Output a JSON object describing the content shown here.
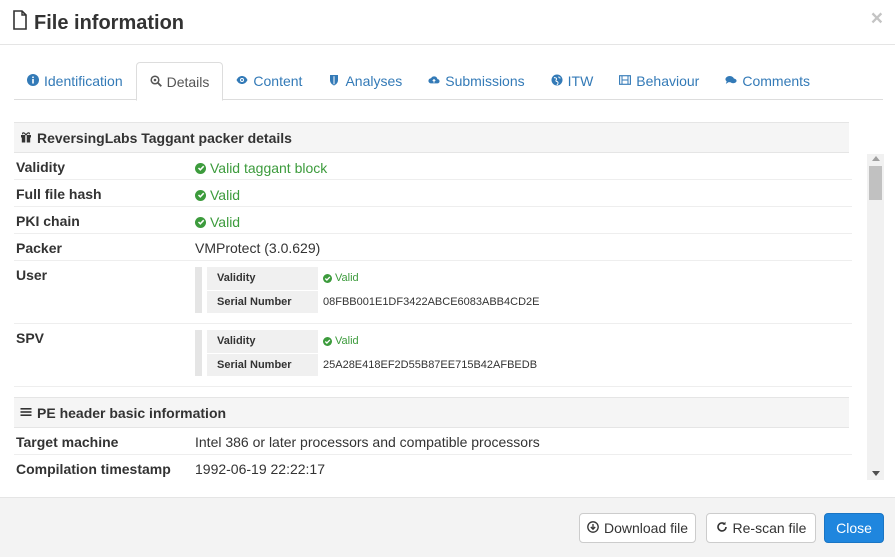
{
  "modal": {
    "title": "File information",
    "close_glyph": "×"
  },
  "tabs": [
    {
      "label": "Identification",
      "icon": "info-circle-icon",
      "active": false
    },
    {
      "label": "Details",
      "icon": "zoom-icon",
      "active": true
    },
    {
      "label": "Content",
      "icon": "eye-icon",
      "active": false
    },
    {
      "label": "Analyses",
      "icon": "shield-icon",
      "active": false
    },
    {
      "label": "Submissions",
      "icon": "cloud-upload-icon",
      "active": false
    },
    {
      "label": "ITW",
      "icon": "globe-icon",
      "active": false
    },
    {
      "label": "Behaviour",
      "icon": "film-icon",
      "active": false
    },
    {
      "label": "Comments",
      "icon": "comments-icon",
      "active": false
    }
  ],
  "taggant": {
    "title": "ReversingLabs Taggant packer details",
    "rows": {
      "validity": {
        "key": "Validity",
        "value": "Valid taggant block"
      },
      "full_hash": {
        "key": "Full file hash",
        "value": "Valid"
      },
      "pki": {
        "key": "PKI chain",
        "value": "Valid"
      },
      "packer": {
        "key": "Packer",
        "value": "VMProtect (3.0.629)"
      }
    },
    "user": {
      "key": "User",
      "validity_label": "Validity",
      "validity_value": "Valid",
      "serial_label": "Serial Number",
      "serial_value": "08FBB001E1DF3422ABCE6083ABB4CD2E"
    },
    "spv": {
      "key": "SPV",
      "validity_label": "Validity",
      "validity_value": "Valid",
      "serial_label": "Serial Number",
      "serial_value": "25A28E418EF2D55B87EE715B42AFBEDB"
    }
  },
  "pe_header": {
    "title": "PE header basic information",
    "rows": {
      "target": {
        "key": "Target machine",
        "value": "Intel 386 or later processors and compatible processors"
      },
      "timestamp": {
        "key": "Compilation timestamp",
        "value": "1992-06-19 22:22:17"
      }
    }
  },
  "footer": {
    "download": "Download file",
    "rescan": "Re-scan file",
    "close": "Close"
  },
  "colors": {
    "link": "#337ab7",
    "valid": "#3c9b3c",
    "primary": "#1f86de"
  }
}
